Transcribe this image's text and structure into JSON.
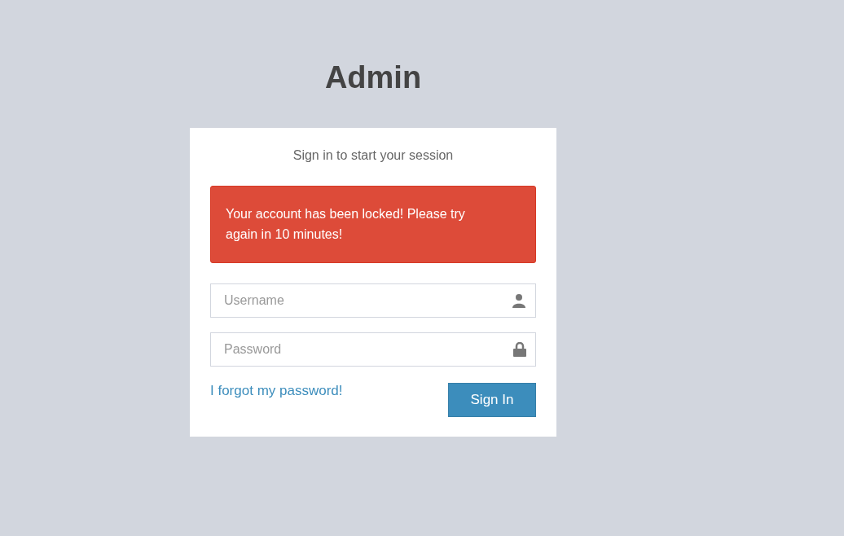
{
  "title": "Admin",
  "login_box": {
    "message": "Sign in to start your session",
    "alert": "Your account has been locked! Please try again in 10 minutes!",
    "fields": [
      {
        "kind": "username",
        "placeholder": "Username"
      },
      {
        "kind": "password",
        "placeholder": "Password"
      }
    ],
    "forgot_link": "I forgot my password!",
    "submit_button": "Sign In"
  }
}
